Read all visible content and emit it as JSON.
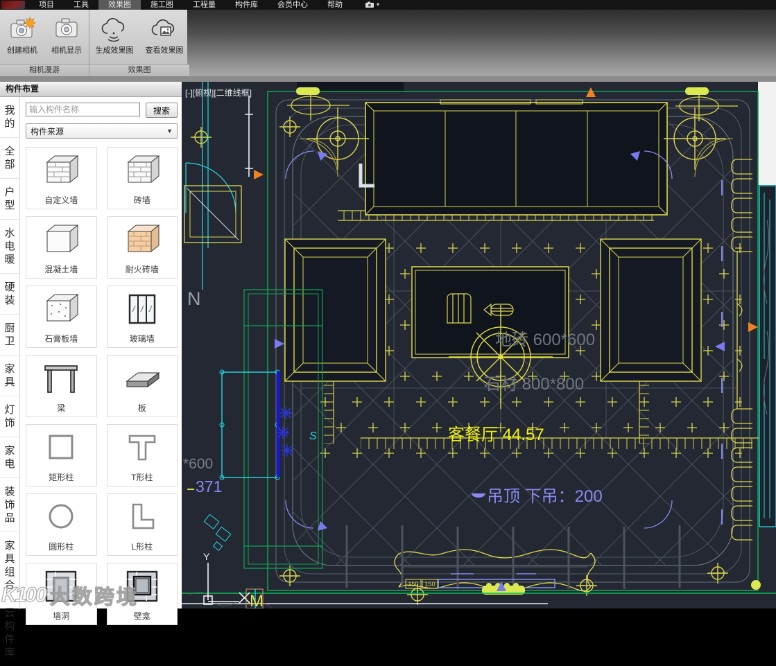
{
  "menubar": {
    "items": [
      {
        "label": "项目"
      },
      {
        "label": "工具"
      },
      {
        "label": "效果图"
      },
      {
        "label": "施工图"
      },
      {
        "label": "工程量"
      },
      {
        "label": "构件库"
      },
      {
        "label": "会员中心"
      },
      {
        "label": "帮助"
      }
    ]
  },
  "ribbon": {
    "groups": [
      {
        "label": "相机漫游",
        "buttons": [
          {
            "label": "创建相机"
          },
          {
            "label": "相机显示"
          }
        ]
      },
      {
        "label": "效果图",
        "buttons": [
          {
            "label": "生成效果图"
          },
          {
            "label": "查看效果图"
          }
        ]
      }
    ]
  },
  "palette": {
    "title": "构件布置",
    "search_placeholder": "输入构件名称",
    "search_button": "搜索",
    "source_dropdown": "构件来源",
    "categories": [
      "我的",
      "全部",
      "户型",
      "水电暖",
      "硬装",
      "厨卫",
      "家具",
      "灯饰",
      "家电",
      "装饰品",
      "家具组合",
      "云构件库"
    ],
    "components": [
      {
        "label": "自定义墙"
      },
      {
        "label": "砖墙"
      },
      {
        "label": "混凝土墙"
      },
      {
        "label": "耐火砖墙"
      },
      {
        "label": "石膏板墙"
      },
      {
        "label": "玻璃墙"
      },
      {
        "label": "梁"
      },
      {
        "label": "板"
      },
      {
        "label": "矩形柱"
      },
      {
        "label": "T形柱"
      },
      {
        "label": "圆形柱"
      },
      {
        "label": "L形柱"
      },
      {
        "label": "墙洞"
      },
      {
        "label": "壁龛"
      }
    ]
  },
  "canvas": {
    "viewport_label": "[-][俯视][二维线框]",
    "room_label": "客餐厅 44.57",
    "ceiling_label": "吊顶 下吊：200",
    "floor_label": "地砖 600*600",
    "stone_label": "石材 800*800",
    "dim_600": "*600",
    "dim_371": "371",
    "dim_150_a": "150",
    "dim_150_b": "150",
    "letter_n": "N",
    "letter_s": "S",
    "letter_y": "Y",
    "letter_m": "M",
    "colors": {
      "background": "#232833",
      "cad_yellow": "#ddd84e",
      "bright_yellow": "#f2f20a",
      "gray_line": "#565c66",
      "green": "#0da153",
      "cyan": "#27d9e4",
      "purple": "#8a8af2",
      "orange": "#ef8322",
      "deep_blue": "#1717cf",
      "highlight": "#d9e94f"
    }
  },
  "watermark": {
    "logo": "K100",
    "text": "大数跨境"
  }
}
